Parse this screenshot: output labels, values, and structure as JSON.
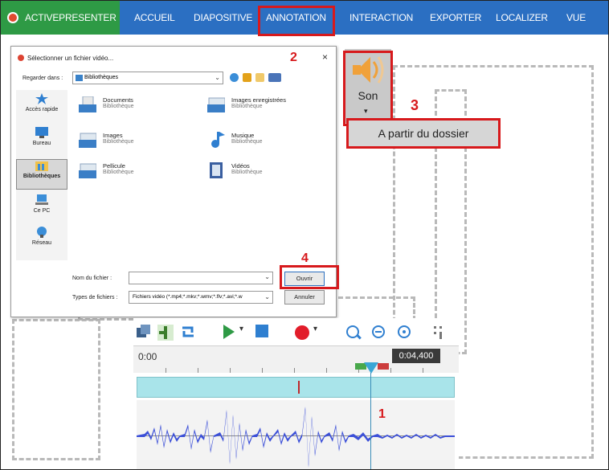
{
  "ribbon": {
    "app_tab": "ACTIVEPRESENTER",
    "tabs": [
      "ACCUEIL",
      "DIAPOSITIVE",
      "ANNOTATION",
      "INTERACTION",
      "EXPORTER",
      "LOCALIZER",
      "VUE"
    ],
    "active_tab": "ANNOTATION"
  },
  "dialog": {
    "title": "Sélectionner un fichier vidéo...",
    "close_glyph": "×",
    "look_in_label": "Regarder dans :",
    "look_in_value": "Bibliothèques",
    "places": [
      "Accès rapide",
      "Bureau",
      "Bibliothèques",
      "Ce PC",
      "Réseau"
    ],
    "selected_place": "Bibliothèques",
    "files": [
      {
        "name": "Documents",
        "type": "Bibliothèque"
      },
      {
        "name": "Images enregistrées",
        "type": "Bibliothèque"
      },
      {
        "name": "Images",
        "type": "Bibliothèque"
      },
      {
        "name": "Musique",
        "type": "Bibliothèque"
      },
      {
        "name": "Pellicule",
        "type": "Bibliothèque"
      },
      {
        "name": "Vidéos",
        "type": "Bibliothèque"
      }
    ],
    "filename_label": "Nom du fichier :",
    "filename_value": "",
    "filetype_label": "Types de fichiers :",
    "filetype_value": "Fichiers vidéo (*.mp4;*.mkv;*.wmv;*.flv;*.avi;*.w",
    "open_button": "Ouvrir",
    "cancel_button": "Annuler"
  },
  "sound": {
    "label": "Son",
    "caret": "▾",
    "menu_item": "A partir du dossier"
  },
  "steps": {
    "one": "1",
    "two": "2",
    "three": "3",
    "four": "4"
  },
  "timeline": {
    "start_time": "0:00",
    "playhead_time": "0:04,400"
  },
  "colors": {
    "ribbon_blue": "#2b6fc2",
    "app_green": "#2e9a45",
    "highlight_red": "#d7191c",
    "waveform_blue": "#3b4fd8",
    "track_cyan": "#a9e4ea"
  }
}
